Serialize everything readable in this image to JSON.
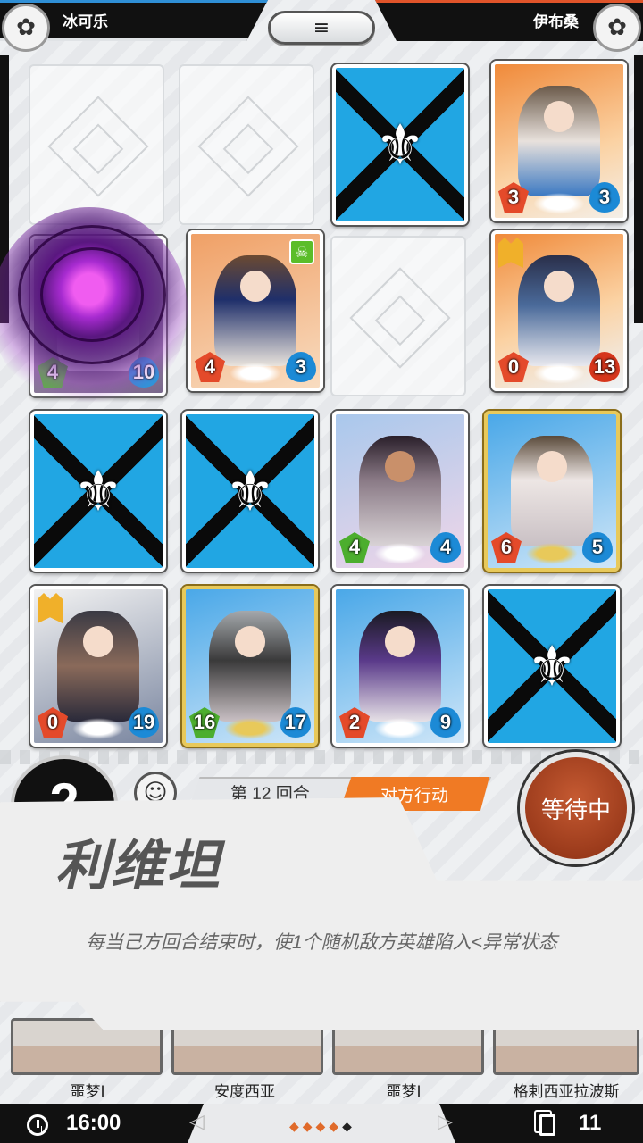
{
  "players": {
    "self_name": "冰可乐",
    "opponent_name": "伊布桑"
  },
  "board": {
    "cards": [
      {
        "slot": "r1c3",
        "type": "back"
      },
      {
        "slot": "r1c4",
        "type": "hero",
        "atk": "3",
        "hp": "3",
        "atk_color": "red",
        "hp_color": "blue",
        "palette": "orange"
      },
      {
        "slot": "r2c1",
        "type": "hero",
        "atk": "4",
        "hp": "10",
        "atk_color": "green",
        "hp_color": "blue",
        "palette": "purple"
      },
      {
        "slot": "r2c2",
        "type": "hero",
        "atk": "4",
        "hp": "3",
        "atk_color": "red",
        "hp_color": "blue",
        "palette": "navy"
      },
      {
        "slot": "r2c4",
        "type": "hero",
        "atk": "0",
        "hp": "13",
        "atk_color": "red",
        "hp_color": "red",
        "palette": "orange"
      },
      {
        "slot": "r3c1",
        "type": "back"
      },
      {
        "slot": "r3c2",
        "type": "back"
      },
      {
        "slot": "r3c3",
        "type": "hero",
        "atk": "4",
        "hp": "4",
        "atk_color": "green",
        "hp_color": "blue",
        "palette": "lilac"
      },
      {
        "slot": "r3c4",
        "type": "hero",
        "atk": "6",
        "hp": "5",
        "atk_color": "red",
        "hp_color": "blue",
        "palette": "sky"
      },
      {
        "slot": "r4c1",
        "type": "hero",
        "atk": "0",
        "hp": "19",
        "atk_color": "red",
        "hp_color": "blue",
        "palette": "dark"
      },
      {
        "slot": "r4c2",
        "type": "hero",
        "atk": "16",
        "hp": "17",
        "atk_color": "green",
        "hp_color": "blue",
        "palette": "grey"
      },
      {
        "slot": "r4c3",
        "type": "hero",
        "atk": "2",
        "hp": "9",
        "atk_color": "red",
        "hp_color": "blue",
        "palette": "violet"
      },
      {
        "slot": "r4c4",
        "type": "back"
      }
    ]
  },
  "hud": {
    "counter": "2",
    "round_label": "第 12 回合",
    "opponent_action": "对方行动",
    "wait_button": "等待中"
  },
  "tooltip": {
    "title": "利维坦",
    "description": "每当己方回合结束时，使1个随机敌方英雄陷入<异常状态"
  },
  "hand": {
    "cards": [
      {
        "name": "噩梦Ⅰ"
      },
      {
        "name": "安度西亚"
      },
      {
        "name": "噩梦Ⅰ"
      },
      {
        "name": "格剌西亚拉波斯"
      }
    ]
  },
  "footer": {
    "time": "16:00",
    "deck_count": "11"
  },
  "colors": {
    "accent_blue": "#2f8fd6",
    "accent_orange": "#f07a24",
    "wait_button": "#a8401c",
    "card_back": "#21a6e3"
  }
}
